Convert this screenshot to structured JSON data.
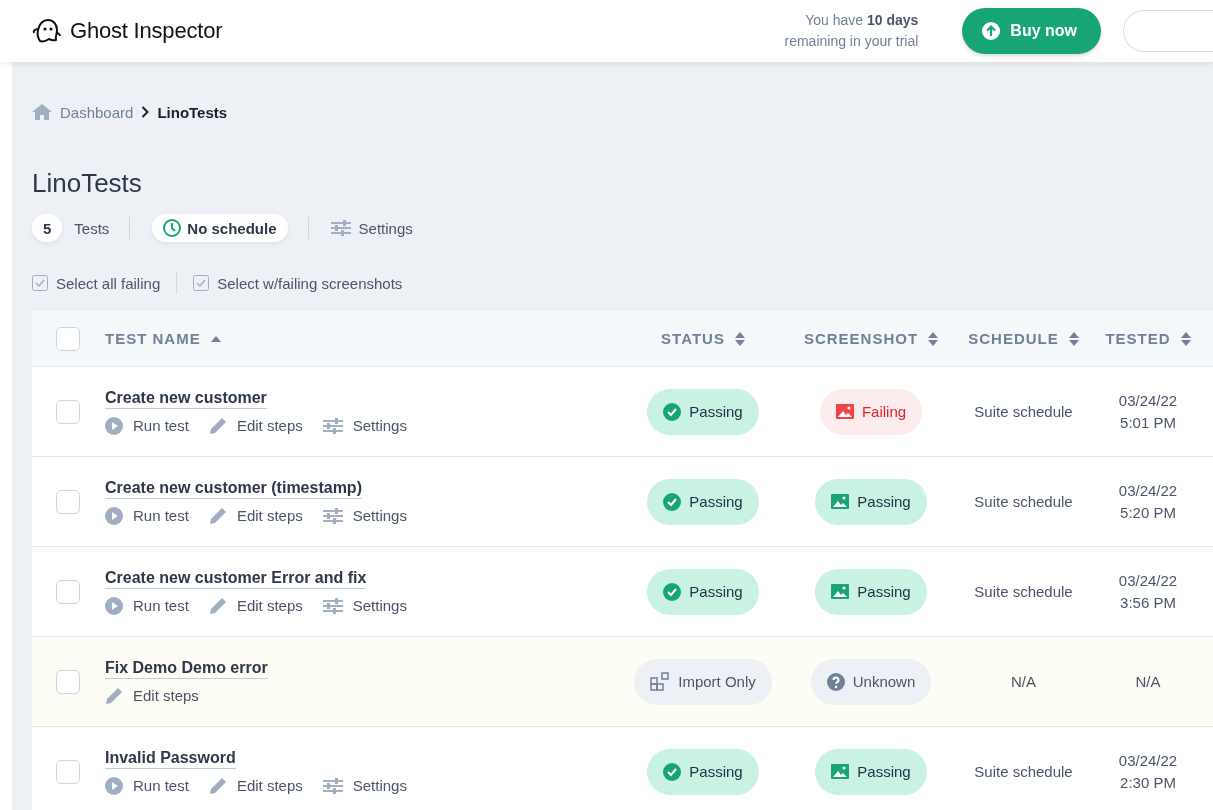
{
  "header": {
    "logo": "Ghost Inspector",
    "trial": "You have **10 days** remaining in your trial",
    "buy_button": "Buy now"
  },
  "breadcrumb": [
    {
      "label": "Dashboard",
      "kind": "home"
    },
    {
      "label": "LinoTests",
      "kind": "current"
    }
  ],
  "title": "LinoTests",
  "summary": {
    "count": "5",
    "count_label": "Tests",
    "schedule": "No schedule",
    "settings": "Settings"
  },
  "bulk_actions": [
    "Select all failing",
    "Select w/failing screenshots"
  ],
  "table": {
    "select_all": {
      "checked": false
    },
    "columns": [
      {
        "label": "TEST NAME",
        "sorted": true
      },
      {
        "label": "STATUS",
        "sorted": false
      },
      {
        "label": "SCREENSHOT",
        "sorted": false
      },
      {
        "label": "SCHEDULE",
        "sorted": false
      },
      {
        "label": "TESTED",
        "sorted": false
      }
    ],
    "rows": [
      {
        "checked": false,
        "name": "Create new customer",
        "actions": [
          {
            "kind": "run",
            "label": "Run test"
          },
          {
            "kind": "edit",
            "label": "Edit steps"
          },
          {
            "kind": "settings",
            "label": "Settings"
          }
        ],
        "status": {
          "kind": "passing",
          "label": "Passing"
        },
        "screenshot": {
          "kind": "failing",
          "label": "Failing"
        },
        "schedule": "Suite schedule",
        "tested": [
          "03/24/22",
          "5:01 PM"
        ]
      },
      {
        "checked": false,
        "name": "Create new customer (timestamp)",
        "actions": [
          {
            "kind": "run",
            "label": "Run test"
          },
          {
            "kind": "edit",
            "label": "Edit steps"
          },
          {
            "kind": "settings",
            "label": "Settings"
          }
        ],
        "status": {
          "kind": "passing",
          "label": "Passing"
        },
        "screenshot": {
          "kind": "passing",
          "label": "Passing"
        },
        "schedule": "Suite schedule",
        "tested": [
          "03/24/22",
          "5:20 PM"
        ]
      },
      {
        "checked": false,
        "name": "Create new customer Error and fix",
        "actions": [
          {
            "kind": "run",
            "label": "Run test"
          },
          {
            "kind": "edit",
            "label": "Edit steps"
          },
          {
            "kind": "settings",
            "label": "Settings"
          }
        ],
        "status": {
          "kind": "passing",
          "label": "Passing"
        },
        "screenshot": {
          "kind": "passing",
          "label": "Passing"
        },
        "schedule": "Suite schedule",
        "tested": [
          "03/24/22",
          "3:56 PM"
        ]
      },
      {
        "checked": false,
        "name": "Fix Demo Demo error",
        "actions": [
          {
            "kind": "edit",
            "label": "Edit steps"
          }
        ],
        "status": {
          "kind": "import",
          "label": "Import Only"
        },
        "screenshot": {
          "kind": "unknown",
          "label": "Unknown"
        },
        "schedule": "N/A",
        "tested": [
          "N/A"
        ]
      },
      {
        "checked": false,
        "name": "Invalid Password",
        "actions": [
          {
            "kind": "run",
            "label": "Run test"
          },
          {
            "kind": "edit",
            "label": "Edit steps"
          },
          {
            "kind": "settings",
            "label": "Settings"
          }
        ],
        "status": {
          "kind": "passing",
          "label": "Passing"
        },
        "screenshot": {
          "kind": "passing",
          "label": "Passing"
        },
        "schedule": "Suite schedule",
        "tested": [
          "03/24/22",
          "2:30 PM"
        ]
      }
    ]
  }
}
